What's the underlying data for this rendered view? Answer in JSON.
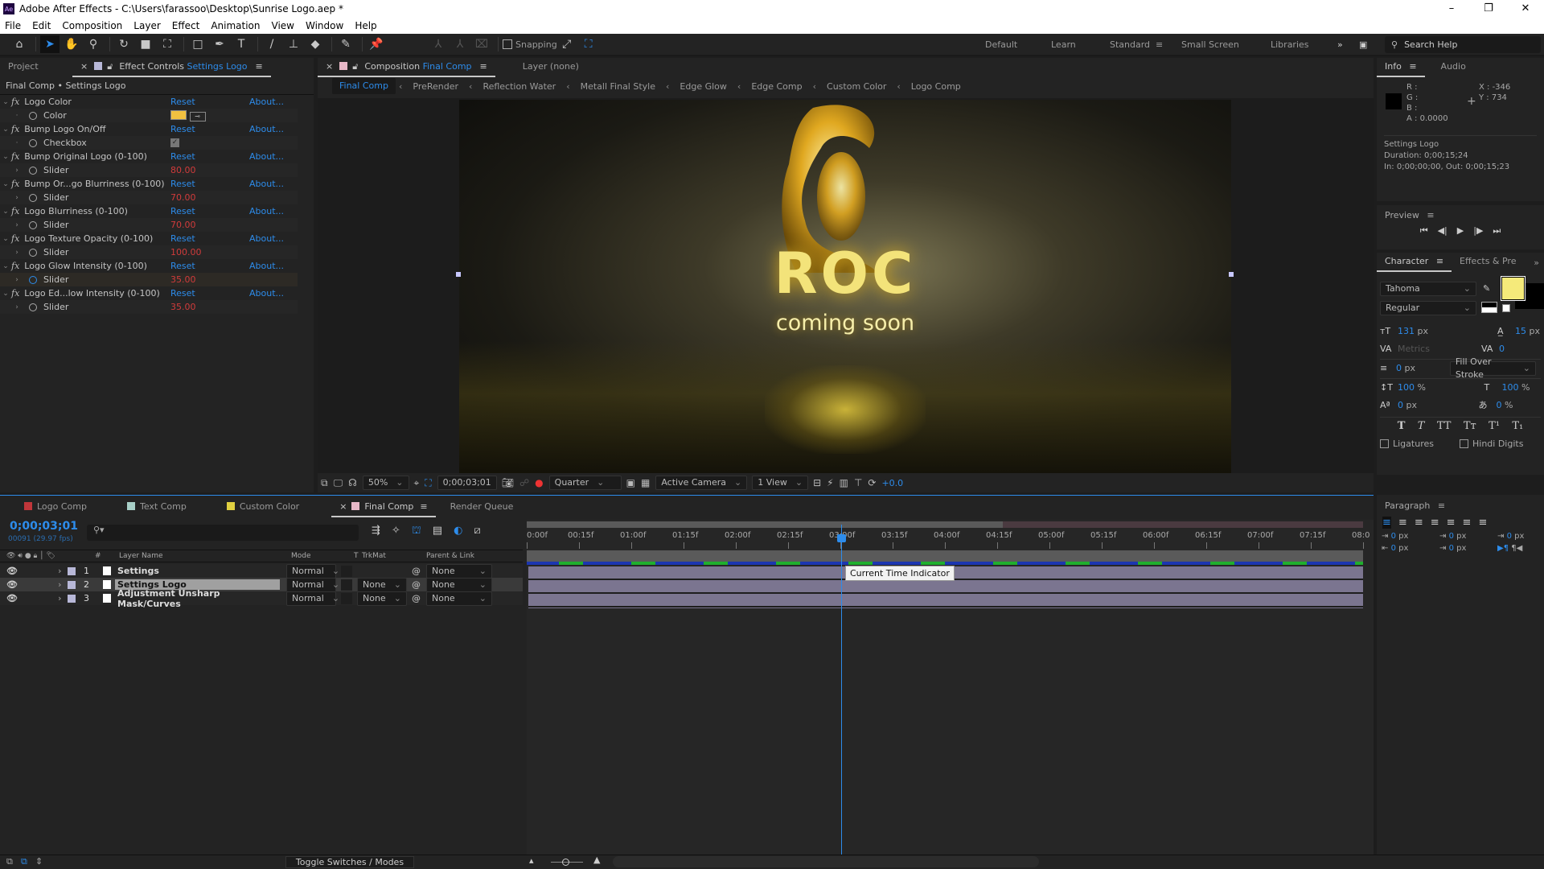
{
  "app": {
    "title": "Adobe After Effects - C:\\Users\\farassoo\\Desktop\\Sunrise Logo.aep *",
    "logo": "Ae"
  },
  "menu": [
    "File",
    "Edit",
    "Composition",
    "Layer",
    "Effect",
    "Animation",
    "View",
    "Window",
    "Help"
  ],
  "toolbar": {
    "snapping": "Snapping",
    "workspaces": [
      "Default",
      "Learn",
      "Standard",
      "Small Screen",
      "Libraries"
    ],
    "active_workspace": "Standard",
    "search_placeholder": "Search Help"
  },
  "left_panel": {
    "tabs": [
      "Project",
      "Effect Controls"
    ],
    "effect_controls_layer": "Settings Logo",
    "breadcrumb": "Final Comp • Settings Logo",
    "reset": "Reset",
    "about": "About...",
    "effects": [
      {
        "name": "Logo Color",
        "param": "Color",
        "type": "color",
        "value": "#f0c040"
      },
      {
        "name": "Bump Logo On/Off",
        "param": "Checkbox",
        "type": "checkbox",
        "value": true
      },
      {
        "name": "Bump Original Logo (0-100)",
        "param": "Slider",
        "type": "slider",
        "value": "80.00"
      },
      {
        "name": "Bump Or...go Blurriness (0-100)",
        "param": "Slider",
        "type": "slider",
        "value": "70.00"
      },
      {
        "name": "Logo Blurriness (0-100)",
        "param": "Slider",
        "type": "slider",
        "value": "70.00"
      },
      {
        "name": "Logo Texture Opacity (0-100)",
        "param": "Slider",
        "type": "slider",
        "value": "100.00"
      },
      {
        "name": "Logo Glow Intensity (0-100)",
        "param": "Slider",
        "type": "slider",
        "value": "35.00"
      },
      {
        "name": "Logo Ed...low Intensity (0-100)",
        "param": "Slider",
        "type": "slider",
        "value": "35.00"
      }
    ]
  },
  "comp_panel": {
    "tab_prefix": "Composition",
    "comp_name": "Final Comp",
    "layer_tab": "Layer (none)",
    "breadcrumbs": [
      "Final Comp",
      "PreRender",
      "Reflection Water",
      "Metall Final Style",
      "Edge Glow",
      "Edge Comp",
      "Custom Color",
      "Logo Comp"
    ],
    "viewer": {
      "logo_text": "ROC",
      "subtitle": "coming soon"
    },
    "controls": {
      "zoom": "50%",
      "timecode": "0;00;03;01",
      "resolution": "Quarter",
      "camera": "Active Camera",
      "views": "1 View",
      "exposure": "+0.0"
    }
  },
  "info": {
    "tabs": [
      "Info",
      "Audio"
    ],
    "r": "R :",
    "g": "G :",
    "b": "B :",
    "a": "A :",
    "a_value": "0.0000",
    "x": "X : -346",
    "y": "Y : 734",
    "layer": "Settings Logo",
    "duration": "Duration: 0;00;15;24",
    "inout": "In: 0;00;00;00, Out: 0;00;15;23"
  },
  "preview": {
    "title": "Preview"
  },
  "character": {
    "tabs": [
      "Character",
      "Effects & Pre"
    ],
    "font": "Tahoma",
    "style": "Regular",
    "fill_color": "#f5ea7a",
    "size": "131",
    "size_unit": "px",
    "leading": "15",
    "leading_unit": "px",
    "kerning": "Metrics",
    "tracking": "0",
    "stroke": "0",
    "stroke_unit": "px",
    "stroke_mode": "Fill Over Stroke",
    "vscale": "100",
    "hscale": "100",
    "pct": "%",
    "baseline": "0",
    "baseline_unit": "px",
    "tsume": "0",
    "tsume_unit": "%",
    "ligatures": "Ligatures",
    "hindi": "Hindi Digits",
    "styles": [
      "T",
      "T",
      "TT",
      "Tт",
      "T¹",
      "T₁"
    ]
  },
  "paragraph": {
    "title": "Paragraph",
    "values": [
      "0",
      "0",
      "0",
      "0",
      "0"
    ],
    "unit": "px"
  },
  "timeline": {
    "tabs": [
      {
        "label": "Logo Comp",
        "color": "#c0363a"
      },
      {
        "label": "Text Comp",
        "color": "#a8d0c8"
      },
      {
        "label": "Custom Color",
        "color": "#e0d040"
      },
      {
        "label": "Final Comp",
        "color": "#e8b8c8"
      },
      {
        "label": "Render Queue",
        "color": ""
      }
    ],
    "timecode": "0;00;03;01",
    "frames": "00091 (29.97 fps)",
    "columns": {
      "num": "#",
      "layer_name": "Layer Name",
      "mode": "Mode",
      "t": "T",
      "trkmat": "TrkMat",
      "parent": "Parent & Link"
    },
    "layers": [
      {
        "num": "1",
        "name": "Settings",
        "mode": "Normal",
        "trkmat": "",
        "parent": "None"
      },
      {
        "num": "2",
        "name": "Settings Logo",
        "mode": "Normal",
        "trkmat": "None",
        "parent": "None"
      },
      {
        "num": "3",
        "name": "Adjustment Unsharp Mask/Curves",
        "mode": "Normal",
        "trkmat": "None",
        "parent": "None"
      }
    ],
    "ruler": [
      "0:00f",
      "00:15f",
      "01:00f",
      "01:15f",
      "02:00f",
      "02:15f",
      "03:00f",
      "03:15f",
      "04:00f",
      "04:15f",
      "05:00f",
      "05:15f",
      "06:00f",
      "06:15f",
      "07:00f",
      "07:15f",
      "08:0"
    ],
    "tooltip": "Current Time Indicator",
    "toggle": "Toggle Switches / Modes"
  }
}
